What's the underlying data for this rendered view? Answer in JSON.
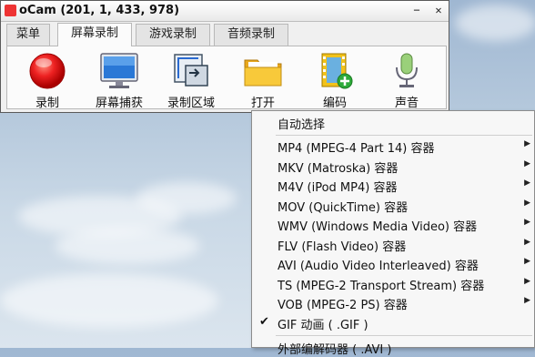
{
  "window": {
    "title": "oCam (201, 1, 433, 978)",
    "buttons": {
      "minimize": "−",
      "close": "✕"
    }
  },
  "tabs": [
    {
      "label": "菜单",
      "active": false
    },
    {
      "label": "屏幕录制",
      "active": true
    },
    {
      "label": "游戏录制",
      "active": false
    },
    {
      "label": "音频录制",
      "active": false
    }
  ],
  "toolbar": [
    {
      "label": "录制",
      "icon": "record-icon"
    },
    {
      "label": "屏幕捕获",
      "icon": "monitor-icon"
    },
    {
      "label": "录制区域",
      "icon": "region-icon"
    },
    {
      "label": "打开",
      "icon": "folder-icon"
    },
    {
      "label": "编码",
      "icon": "film-add-icon"
    },
    {
      "label": "声音",
      "icon": "microphone-icon"
    }
  ],
  "menu": {
    "auto_select": "自动选择",
    "items": [
      {
        "label": "MP4 (MPEG-4 Part 14) 容器",
        "submenu": true
      },
      {
        "label": "MKV (Matroska) 容器",
        "submenu": true
      },
      {
        "label": "M4V (iPod MP4) 容器",
        "submenu": true
      },
      {
        "label": "MOV (QuickTime) 容器",
        "submenu": true
      },
      {
        "label": "WMV (Windows Media Video) 容器",
        "submenu": true
      },
      {
        "label": "FLV (Flash Video) 容器",
        "submenu": true
      },
      {
        "label": "AVI (Audio Video Interleaved) 容器",
        "submenu": true
      },
      {
        "label": "TS (MPEG-2 Transport Stream) 容器",
        "submenu": true
      },
      {
        "label": "VOB (MPEG-2 PS) 容器",
        "submenu": true
      },
      {
        "label": "GIF 动画 ( .GIF )",
        "submenu": false,
        "checked": true
      }
    ],
    "external": "外部编解码器 ( .AVI )",
    "check_mark": "✔",
    "arrow": "▶"
  }
}
